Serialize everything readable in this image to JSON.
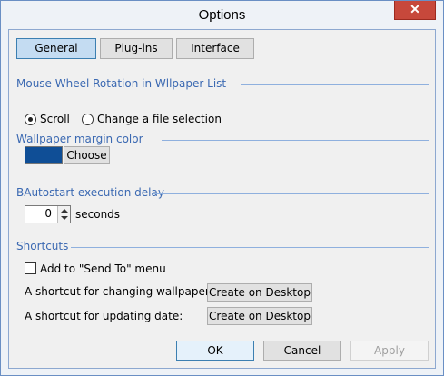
{
  "window": {
    "title": "Options",
    "close_symbol": "✕"
  },
  "tabs": [
    {
      "label": "General"
    },
    {
      "label": "Plug-ins"
    },
    {
      "label": "Interface"
    }
  ],
  "mouse_wheel": {
    "heading": "Mouse Wheel Rotation in Wllpaper List",
    "options": [
      {
        "label": "Scroll",
        "selected": true
      },
      {
        "label": "Change a file selection",
        "selected": false
      }
    ]
  },
  "margin_color": {
    "heading": "Wallpaper margin color",
    "color": "#0f4e96",
    "choose_label": "Choose"
  },
  "autostart": {
    "heading": "BAutostart execution delay",
    "value": "0",
    "unit": "seconds"
  },
  "shortcuts": {
    "heading": "Shortcuts",
    "send_to_label": "Add to \"Send To\" menu",
    "send_to_checked": false,
    "wallpaper_label": "A shortcut for changing wallpaper:",
    "wallpaper_button": "Create on Desktop",
    "date_label": "A shortcut for updating date:",
    "date_button": "Create on Desktop"
  },
  "footer": {
    "ok_label": "OK",
    "cancel_label": "Cancel",
    "apply_label": "Apply"
  }
}
